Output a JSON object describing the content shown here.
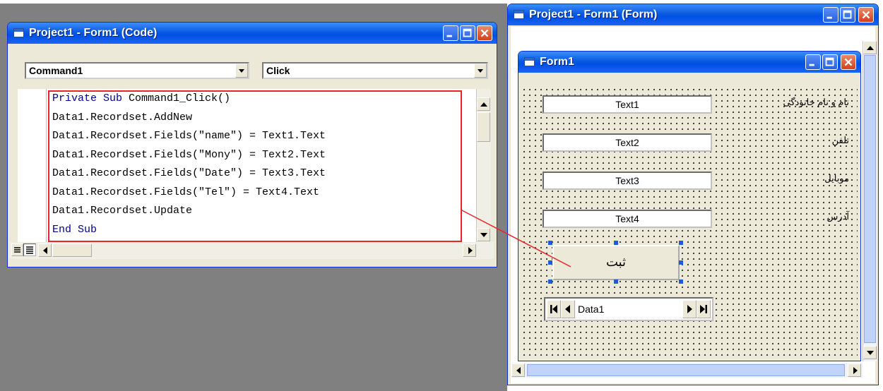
{
  "code_window": {
    "title": "Project1 - Form1 (Code)",
    "object_combo": "Command1",
    "procedure_combo": "Click",
    "lines": [
      {
        "kw": "Private Sub ",
        "text": "Command1_Click()"
      },
      {
        "kw": "",
        "text": "Data1.Recordset.AddNew"
      },
      {
        "kw": "",
        "text": "Data1.Recordset.Fields(\"name\") = Text1.Text"
      },
      {
        "kw": "",
        "text": "Data1.Recordset.Fields(\"Mony\") = Text2.Text"
      },
      {
        "kw": "",
        "text": "Data1.Recordset.Fields(\"Date\") = Text3.Text"
      },
      {
        "kw": "",
        "text": "Data1.Recordset.Fields(\"Tel\") = Text4.Text"
      },
      {
        "kw": "",
        "text": "Data1.Recordset.Update"
      },
      {
        "kw": "End Sub",
        "text": ""
      }
    ]
  },
  "form_designer": {
    "title": "Project1 - Form1 (Form)",
    "form": {
      "title": "Form1",
      "textboxes": [
        {
          "value": "Text1",
          "label": "نام و نام خانودگی"
        },
        {
          "value": "Text2",
          "label": "تلفن"
        },
        {
          "value": "Text3",
          "label": "موبایل"
        },
        {
          "value": "Text4",
          "label": "آدرس"
        }
      ],
      "button_label": "ثبت",
      "data_control_caption": "Data1"
    }
  },
  "colors": {
    "titlebar": "#0a5ae0",
    "highlight_box": "#e8262a",
    "selection_handle": "#1e5bd4",
    "keyword": "#00008b"
  }
}
